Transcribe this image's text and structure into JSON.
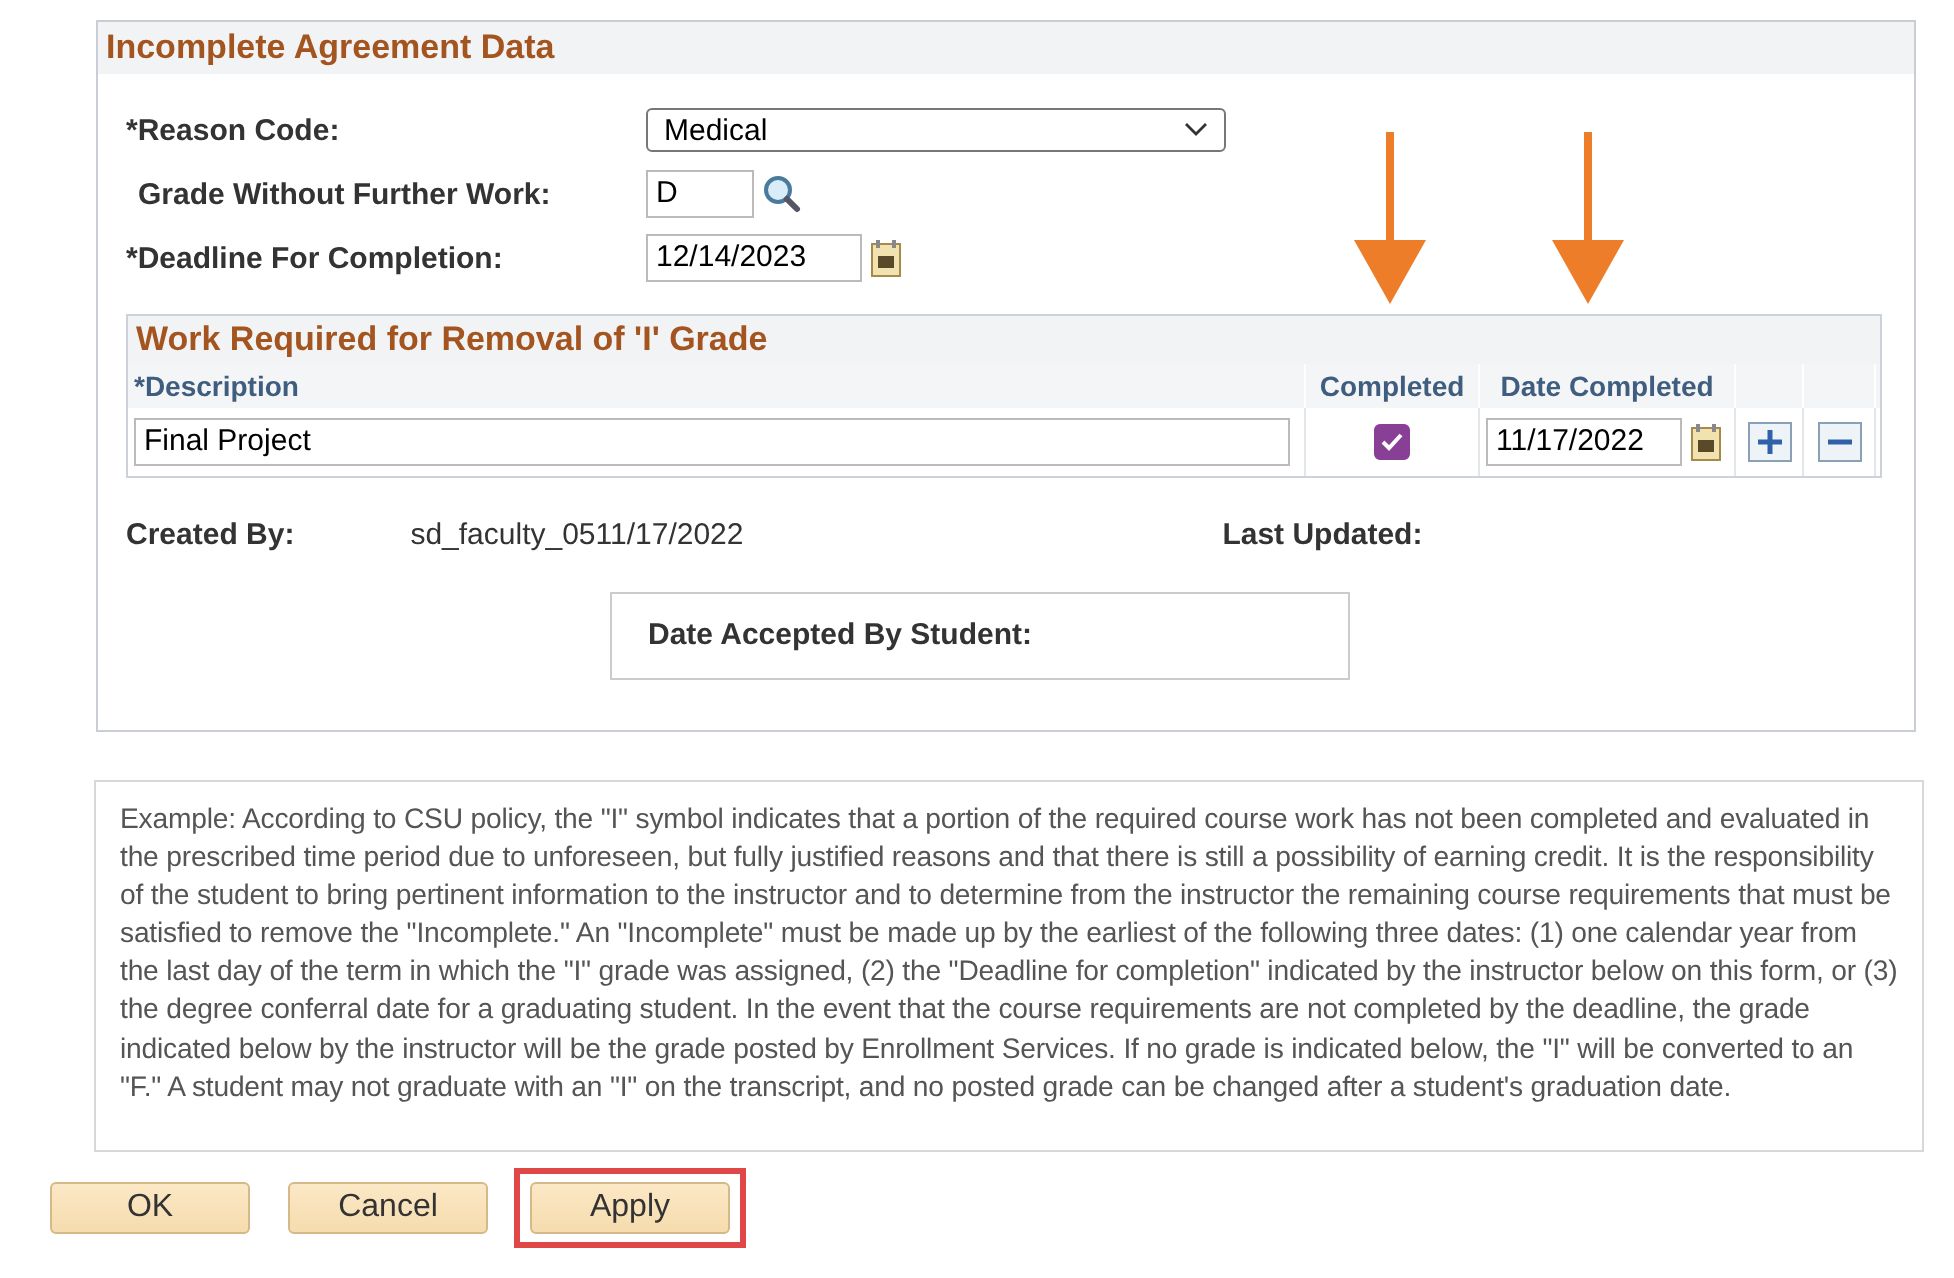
{
  "section": {
    "title": "Incomplete Agreement Data"
  },
  "fields": [
    {
      "kind": "select",
      "label": "*Reason Code:",
      "value": "Medical"
    },
    {
      "kind": "lookup",
      "label": "Grade Without Further Work:",
      "value": "D"
    },
    {
      "kind": "date",
      "label": "*Deadline For Completion:",
      "value": "12/14/2023"
    }
  ],
  "work_table": {
    "title": "Work Required for Removal of 'I' Grade",
    "columns": [
      "*Description",
      "Completed",
      "Date Completed"
    ],
    "rows": [
      {
        "description": "Final Project",
        "completed": true,
        "date_completed": "11/17/2022"
      }
    ]
  },
  "created_by": {
    "label": "Created By:",
    "value": "sd_faculty_0511/17/2022"
  },
  "last_updated": {
    "label": "Last Updated:"
  },
  "date_accepted": {
    "label": "Date Accepted By Student:"
  },
  "annotations": [
    {
      "kind": "arrow"
    },
    {
      "kind": "arrow"
    }
  ],
  "policy_text": "Example: According to CSU policy, the \"I\" symbol indicates that a portion of the required course work has not been completed and evaluated in the prescribed time period due to unforeseen, but fully justified reasons and that there is still a possibility of earning credit. It is the responsibility of the student to bring pertinent information to the instructor and to determine from the instructor the remaining course requirements that must be satisfied to remove the \"Incomplete.\"  An \"Incomplete\" must be made up by the earliest of the following three dates: (1) one calendar year from the last day of the term in which the \"I\" grade was assigned, (2) the \"Deadline for completion\" indicated by the instructor below on this form, or (3) the degree conferral date for a graduating student.  In the event that the course requirements are not completed by the deadline, the grade indicated below by the instructor will be the grade posted by Enrollment Services.  If no grade is indicated below, the \"I\" will be converted to an \"F.\"  A student may not graduate with an \"I\" on the transcript, and no posted grade can be changed after a student's graduation date.",
  "buttons": [
    {
      "label": "OK",
      "highlighted": false
    },
    {
      "label": "Cancel",
      "highlighted": false
    },
    {
      "label": "Apply",
      "highlighted": true
    }
  ]
}
